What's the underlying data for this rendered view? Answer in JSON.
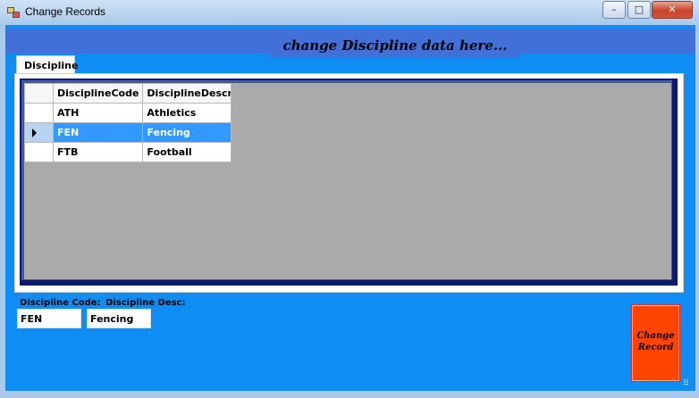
{
  "window": {
    "title": "Change Records",
    "controls": {
      "minimize": "–",
      "maximize": "□",
      "close": "✕"
    }
  },
  "header": {
    "text": "change Discipline data here..."
  },
  "tabs": [
    {
      "label": "Discipline"
    }
  ],
  "grid": {
    "columns": [
      "DisciplineCode",
      "DisciplineDescript"
    ],
    "rows": [
      {
        "code": "ATH",
        "desc": "Athletics",
        "selected": false
      },
      {
        "code": "FEN",
        "desc": "Fencing",
        "selected": true
      },
      {
        "code": "FTB",
        "desc": "Football",
        "selected": false
      }
    ]
  },
  "form": {
    "code_label": "Discipline Code:",
    "desc_label": "Discipline Desc:",
    "code_value": "FEN",
    "desc_value": "Fencing"
  },
  "buttons": {
    "change_record": "Change Record"
  },
  "colors": {
    "client_bg": "#0e8df5",
    "header_bg": "#4070d8",
    "selection": "#3399ff",
    "button": "#ff4500"
  }
}
